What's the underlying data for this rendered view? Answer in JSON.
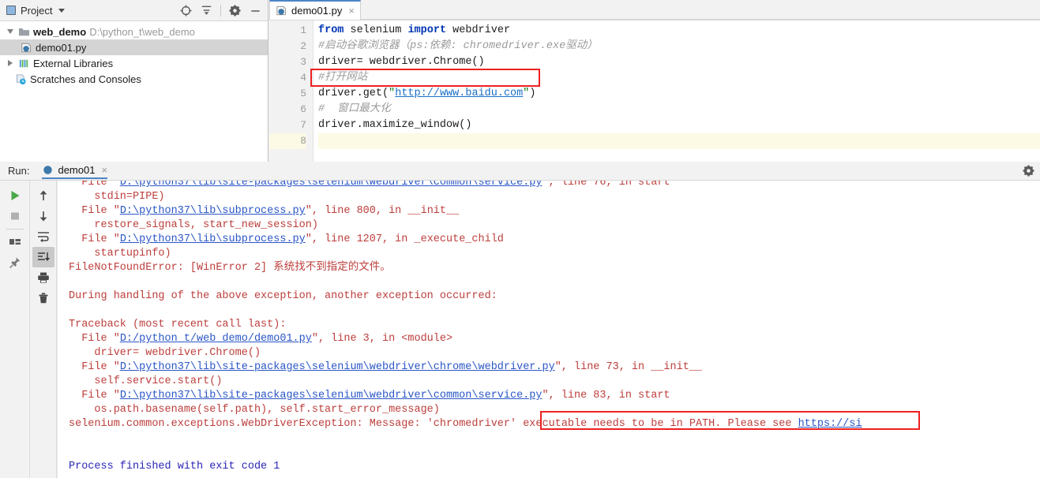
{
  "project_panel": {
    "title": "Project",
    "icons": [
      "locate-icon",
      "collapse-all-icon",
      "settings-gear-icon",
      "minimize-icon"
    ],
    "tree": [
      {
        "icon": "folder-icon",
        "name": "web_demo",
        "path": "D:\\python_t\\web_demo",
        "expanded": true,
        "selected": false,
        "indent": 0
      },
      {
        "icon": "python-file-icon",
        "name": "demo01.py",
        "path": "",
        "expanded": null,
        "selected": true,
        "indent": 1
      },
      {
        "icon": "library-icon",
        "name": "External Libraries",
        "path": "",
        "expanded": false,
        "selected": false,
        "indent": 0
      },
      {
        "icon": "scratches-icon",
        "name": "Scratches and Consoles",
        "path": "",
        "expanded": null,
        "selected": false,
        "indent": 0
      }
    ]
  },
  "editor": {
    "tab": {
      "icon": "python-file-icon",
      "label": "demo01.py",
      "close": "×"
    },
    "line_numbers": [
      "1",
      "2",
      "3",
      "4",
      "5",
      "6",
      "7",
      "8"
    ],
    "highlighted_line": 8,
    "lines": [
      {
        "n": 1,
        "segments": [
          {
            "t": "from ",
            "c": "kw"
          },
          {
            "t": "selenium ",
            "c": "plain"
          },
          {
            "t": "import ",
            "c": "kw"
          },
          {
            "t": "webdriver",
            "c": "plain"
          }
        ]
      },
      {
        "n": 2,
        "segments": [
          {
            "t": "#启动谷歌浏览器（ps:依赖: chromedriver.exe驱动）",
            "c": "cmt"
          }
        ]
      },
      {
        "n": 3,
        "segments": [
          {
            "t": "driver= webdriver.Chrome()",
            "c": "plain"
          }
        ]
      },
      {
        "n": 4,
        "segments": [
          {
            "t": "#打开网站",
            "c": "cmt"
          }
        ]
      },
      {
        "n": 5,
        "segments": [
          {
            "t": "driver.get(",
            "c": "plain"
          },
          {
            "t": "\"",
            "c": "str"
          },
          {
            "t": "http://www.baidu.com",
            "c": "strlink"
          },
          {
            "t": "\"",
            "c": "str"
          },
          {
            "t": ")",
            "c": "plain"
          }
        ]
      },
      {
        "n": 6,
        "segments": [
          {
            "t": "#  窗口最大化",
            "c": "cmt"
          }
        ]
      },
      {
        "n": 7,
        "segments": [
          {
            "t": "driver.maximize_window()",
            "c": "plain"
          }
        ]
      },
      {
        "n": 8,
        "segments": [
          {
            "t": "",
            "c": "plain"
          }
        ]
      }
    ],
    "annotation_box": "red-highlight-box-line3"
  },
  "run_panel": {
    "label": "Run:",
    "tab": {
      "icon": "python-run-icon",
      "label": "demo01",
      "close": "×"
    },
    "gear_icon": "settings-gear-icon",
    "toolbar_left": [
      {
        "icon": "run-play-icon",
        "name": "rerun-button",
        "state": "enabled"
      },
      {
        "icon": "stop-square-icon",
        "name": "stop-button",
        "state": "disabled"
      },
      {
        "icon": "layout-console-icon",
        "name": "console-toggle-button",
        "state": "enabled"
      },
      {
        "icon": "pin-icon",
        "name": "pin-tab-button",
        "state": "enabled"
      }
    ],
    "toolbar_right": [
      {
        "icon": "arrow-up-icon",
        "name": "prev-occurrence-button",
        "state": "enabled"
      },
      {
        "icon": "arrow-down-icon",
        "name": "next-occurrence-button",
        "state": "enabled"
      },
      {
        "icon": "soft-wrap-icon",
        "name": "soft-wrap-button",
        "state": "enabled"
      },
      {
        "icon": "scroll-to-end-icon",
        "name": "scroll-to-end-button",
        "state": "active"
      },
      {
        "icon": "printer-icon",
        "name": "print-button",
        "state": "enabled"
      },
      {
        "icon": "trash-icon",
        "name": "clear-all-button",
        "state": "enabled"
      }
    ],
    "annotation_box": "red-highlight-box-chromedriver-path",
    "console_lines": [
      {
        "clipped": true,
        "segments": [
          {
            "t": "  File \"",
            "c": "err"
          },
          {
            "t": "D:\\python37\\lib\\site-packages\\selenium\\webdriver\\common\\service.py",
            "c": "lnk"
          },
          {
            "t": "\", line 76, in start",
            "c": "err"
          }
        ]
      },
      {
        "segments": [
          {
            "t": "    stdin=PIPE)",
            "c": "err"
          }
        ]
      },
      {
        "segments": [
          {
            "t": "  File \"",
            "c": "err"
          },
          {
            "t": "D:\\python37\\lib\\subprocess.py",
            "c": "lnk"
          },
          {
            "t": "\", line 800, in __init__",
            "c": "err"
          }
        ]
      },
      {
        "segments": [
          {
            "t": "    restore_signals, start_new_session)",
            "c": "err"
          }
        ]
      },
      {
        "segments": [
          {
            "t": "  File \"",
            "c": "err"
          },
          {
            "t": "D:\\python37\\lib\\subprocess.py",
            "c": "lnk"
          },
          {
            "t": "\", line 1207, in _execute_child",
            "c": "err"
          }
        ]
      },
      {
        "segments": [
          {
            "t": "    startupinfo)",
            "c": "err"
          }
        ]
      },
      {
        "segments": [
          {
            "t": "FileNotFoundError: [WinError 2] 系统找不到指定的文件。",
            "c": "err"
          }
        ]
      },
      {
        "segments": [
          {
            "t": "",
            "c": "err"
          }
        ]
      },
      {
        "segments": [
          {
            "t": "During handling of the above exception, another exception occurred:",
            "c": "err"
          }
        ]
      },
      {
        "segments": [
          {
            "t": "",
            "c": "err"
          }
        ]
      },
      {
        "segments": [
          {
            "t": "Traceback (most recent call last):",
            "c": "err"
          }
        ]
      },
      {
        "segments": [
          {
            "t": "  File \"",
            "c": "err"
          },
          {
            "t": "D:/python_t/web_demo/demo01.py",
            "c": "lnk"
          },
          {
            "t": "\", line 3, in <module>",
            "c": "err"
          }
        ]
      },
      {
        "segments": [
          {
            "t": "    driver= webdriver.Chrome()",
            "c": "err"
          }
        ]
      },
      {
        "segments": [
          {
            "t": "  File \"",
            "c": "err"
          },
          {
            "t": "D:\\python37\\lib\\site-packages\\selenium\\webdriver\\chrome\\webdriver.py",
            "c": "lnk"
          },
          {
            "t": "\", line 73, in __init__",
            "c": "err"
          }
        ]
      },
      {
        "segments": [
          {
            "t": "    self.service.start()",
            "c": "err"
          }
        ]
      },
      {
        "segments": [
          {
            "t": "  File \"",
            "c": "err"
          },
          {
            "t": "D:\\python37\\lib\\site-packages\\selenium\\webdriver\\common\\service.py",
            "c": "lnk"
          },
          {
            "t": "\", line 83, in start",
            "c": "err"
          }
        ]
      },
      {
        "segments": [
          {
            "t": "    os.path.basename(self.path), self.start_error_message)",
            "c": "err"
          }
        ]
      },
      {
        "segments": [
          {
            "t": "selenium.common.exceptions.WebDriverException: Message: ",
            "c": "err"
          },
          {
            "t": "'chromedriver' executable needs to be in PATH. ",
            "c": "err"
          },
          {
            "t": "Please see ",
            "c": "err"
          },
          {
            "t": "https://si",
            "c": "lnk"
          }
        ]
      },
      {
        "segments": [
          {
            "t": "",
            "c": "err"
          }
        ]
      },
      {
        "segments": [
          {
            "t": "",
            "c": "err"
          }
        ]
      },
      {
        "segments": [
          {
            "t": "Process finished with exit code 1",
            "c": "blue"
          }
        ]
      }
    ]
  },
  "colors": {
    "accent_tab": "#4a86c8",
    "error_red": "#bc3f3c",
    "link_blue": "#2a56c6",
    "annotation_red": "#ee2020",
    "keyword_blue": "#0033b3",
    "comment_gray": "#9b9b9b",
    "current_line": "#fcfae4"
  }
}
